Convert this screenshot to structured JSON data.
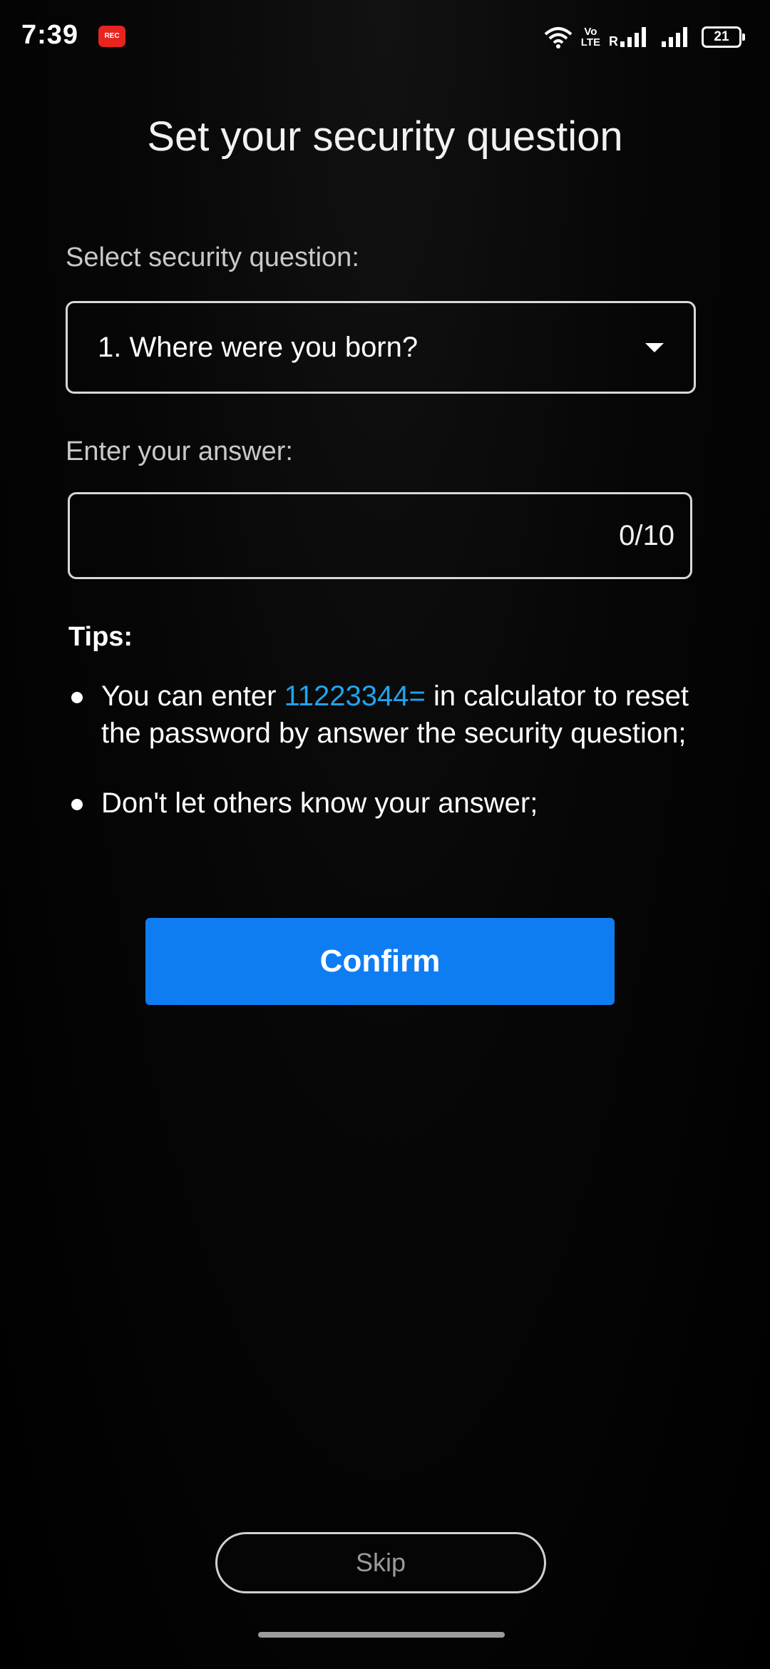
{
  "status_bar": {
    "time": "7:39",
    "app_badge": "REC",
    "volte_top": "Vo",
    "volte_bottom": "LTE",
    "signal_label": "R",
    "battery": "21",
    "icons": [
      "wifi-icon",
      "volte-icon",
      "signal-roaming-icon",
      "signal-icon",
      "battery-icon"
    ]
  },
  "page": {
    "title": "Set your security question"
  },
  "question": {
    "label": "Select security question:",
    "selected": "1. Where were you born?"
  },
  "answer": {
    "label": "Enter your answer:",
    "value": "",
    "counter": "0/10"
  },
  "tips": {
    "heading": "Tips:",
    "tip1_before": "You can enter ",
    "tip1_code": "11223344=",
    "tip1_after": " in calculator to reset the password by answer the security question;",
    "tip2": "Don't let others know your answer;"
  },
  "actions": {
    "confirm": "Confirm",
    "skip": "Skip"
  },
  "colors": {
    "accent": "#0f7df2",
    "highlight": "#1fa4f0",
    "background": "#000000"
  }
}
